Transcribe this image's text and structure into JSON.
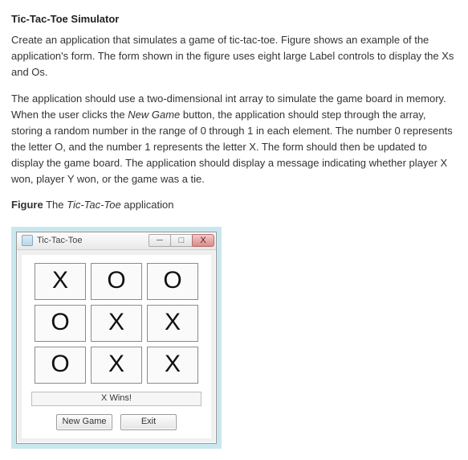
{
  "doc": {
    "title": "Tic-Tac-Toe Simulator",
    "para1": "Create an application that simulates a game of tic-tac-toe. Figure shows an example of the application's form. The form shown in the figure uses eight large Label controls to display the Xs and Os.",
    "para2_a": "The application should use a two-dimensional int array to simulate the game board in memory. When the user clicks the ",
    "para2_em": "New Game",
    "para2_b": " button, the application should step through the array, storing a random number in the range of 0 through 1 in each element. The number 0 represents the letter O, and the number 1 represents the letter X. The form should then be updated to display the game board. The application should display a message indicating whether player X won, player Y won, or the game was a tie.",
    "figcap_a": "Figure",
    "figcap_b": " The ",
    "figcap_em": "Tic-Tac-Toe",
    "figcap_c": " application"
  },
  "window": {
    "title": "Tic-Tac-Toe",
    "min_glyph": "─",
    "max_glyph": "□",
    "close_glyph": "X",
    "status": "X Wins!",
    "buttons": {
      "new_game": "New Game",
      "exit": "Exit"
    },
    "board": [
      [
        "X",
        "O",
        "O"
      ],
      [
        "O",
        "X",
        "X"
      ],
      [
        "O",
        "X",
        "X"
      ]
    ]
  }
}
